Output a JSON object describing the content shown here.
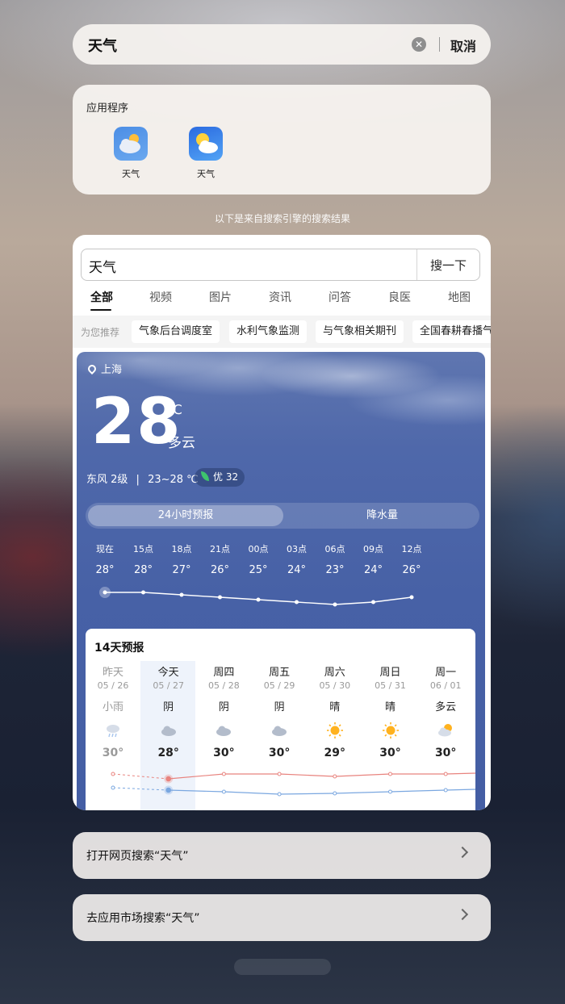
{
  "search": {
    "query": "天气",
    "cancel_label": "取消"
  },
  "apps": {
    "title": "应用程序",
    "items": [
      {
        "label": "天气",
        "icon": "weather-cloud-icon"
      },
      {
        "label": "天气",
        "icon": "weather-sun-cloud-icon"
      }
    ]
  },
  "engine_note": "以下是来自搜索引擎的搜索结果",
  "engine": {
    "query": "天气",
    "search_button": "搜一下",
    "tabs": [
      "全部",
      "视频",
      "图片",
      "资讯",
      "问答",
      "良医",
      "地图"
    ],
    "recommend_lead": "为您推荐",
    "chips": [
      "气象后台调度室",
      "水利气象监测",
      "与气象相关期刊",
      "全国春耕春播气"
    ]
  },
  "weather": {
    "location": "上海",
    "temp": "28",
    "unit": "℃",
    "condition": "多云",
    "wind": "东风 2级",
    "sep": "|",
    "range": "23~28 ℃",
    "aqi": "优 32",
    "toggle_on": "24小时预报",
    "toggle_off": "降水量",
    "hourly": [
      {
        "time": "现在",
        "temp": "28°",
        "value": 28
      },
      {
        "time": "15点",
        "temp": "28°",
        "value": 28
      },
      {
        "time": "18点",
        "temp": "27°",
        "value": 27
      },
      {
        "time": "21点",
        "temp": "26°",
        "value": 26
      },
      {
        "time": "00点",
        "temp": "25°",
        "value": 25
      },
      {
        "time": "03点",
        "temp": "24°",
        "value": 24
      },
      {
        "time": "06点",
        "temp": "23°",
        "value": 23
      },
      {
        "time": "09点",
        "temp": "24°",
        "value": 24
      },
      {
        "time": "12点",
        "temp": "26°",
        "value": 26
      }
    ],
    "forecast_title": "14天预报",
    "days": [
      {
        "name": "昨天",
        "date": "05 / 26",
        "cond": "小雨",
        "high": "30°",
        "icon": "rain-icon",
        "high_v": 30
      },
      {
        "name": "今天",
        "date": "05 / 27",
        "cond": "阴",
        "high": "28°",
        "icon": "overcast-icon",
        "high_v": 28
      },
      {
        "name": "周四",
        "date": "05 / 28",
        "cond": "阴",
        "high": "30°",
        "icon": "overcast-icon",
        "high_v": 30
      },
      {
        "name": "周五",
        "date": "05 / 29",
        "cond": "阴",
        "high": "30°",
        "icon": "overcast-icon",
        "high_v": 30
      },
      {
        "name": "周六",
        "date": "05 / 30",
        "cond": "晴",
        "high": "29°",
        "icon": "sun-icon",
        "high_v": 29
      },
      {
        "name": "周日",
        "date": "05 / 31",
        "cond": "晴",
        "high": "30°",
        "icon": "sun-icon",
        "high_v": 30
      },
      {
        "name": "周一",
        "date": "06 / 01",
        "cond": "多云",
        "high": "30°",
        "icon": "partly-cloudy-icon",
        "high_v": 30
      }
    ]
  },
  "actions": [
    "打开网页搜索“天气”",
    "去应用市场搜索“天气”"
  ],
  "colors": {
    "weather_bg": "#4761a6",
    "high_line": "#e8837e",
    "low_line": "#7aa7e0"
  }
}
